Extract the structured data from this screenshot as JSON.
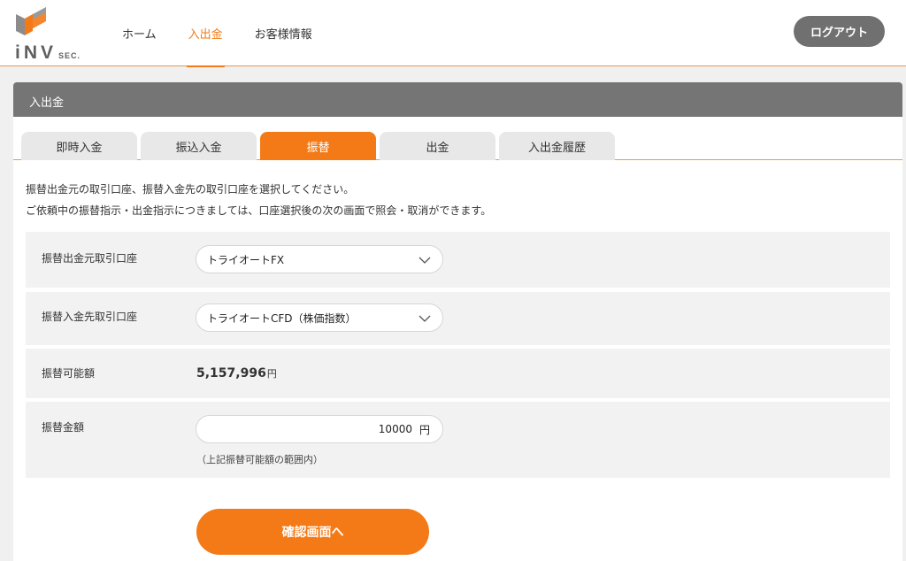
{
  "header": {
    "logo_text": "iNV",
    "logo_sub": "SEC.",
    "nav": [
      {
        "label": "ホーム"
      },
      {
        "label": "入出金"
      },
      {
        "label": "お客様情報"
      }
    ],
    "active_nav": 1,
    "logout_label": "ログアウト"
  },
  "panel": {
    "title": "入出金",
    "tabs": [
      {
        "label": "即時入金"
      },
      {
        "label": "振込入金"
      },
      {
        "label": "振替"
      },
      {
        "label": "出金"
      },
      {
        "label": "入出金履歴"
      }
    ],
    "active_tab": 2,
    "description": [
      "振替出金元の取引口座、振替入金先の取引口座を選択してください。",
      "ご依頼中の振替指示・出金指示につきましては、口座選択後の次の画面で照会・取消ができます。"
    ]
  },
  "form": {
    "from_account": {
      "label": "振替出金元取引口座",
      "value": "トライオートFX"
    },
    "to_account": {
      "label": "振替入金先取引口座",
      "value": "トライオートCFD（株価指数）"
    },
    "available": {
      "label": "振替可能額",
      "value": "5,157,996",
      "unit": "円"
    },
    "amount": {
      "label": "振替金額",
      "value": "10000",
      "unit": "円",
      "hint": "（上記振替可能額の範囲内）"
    },
    "confirm_label": "確認画面へ"
  },
  "colors": {
    "accent": "#f37a17",
    "header_gray": "#757575",
    "button_gray": "#707070"
  }
}
